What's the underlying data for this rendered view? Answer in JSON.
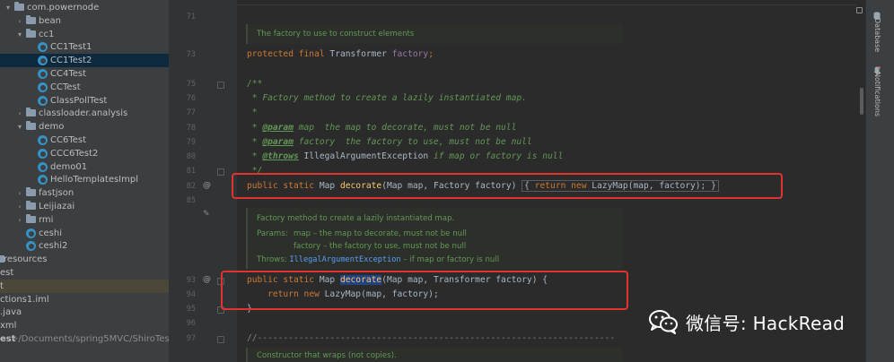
{
  "project_tree": {
    "items": [
      {
        "label": "com.powernode",
        "type": "package",
        "indent": 0,
        "expanded": true
      },
      {
        "label": "bean",
        "type": "folder",
        "indent": 1,
        "expanded": false
      },
      {
        "label": "cc1",
        "type": "folder",
        "indent": 1,
        "expanded": true
      },
      {
        "label": "CC1Test1",
        "type": "class",
        "indent": 2
      },
      {
        "label": "CC1Test2",
        "type": "class",
        "indent": 2,
        "selected": true
      },
      {
        "label": "CC4Test",
        "type": "class",
        "indent": 2
      },
      {
        "label": "CCTest",
        "type": "class",
        "indent": 2
      },
      {
        "label": "ClassPollTest",
        "type": "class",
        "indent": 2
      },
      {
        "label": "classloader.analysis",
        "type": "folder",
        "indent": 1,
        "expanded": false
      },
      {
        "label": "demo",
        "type": "folder",
        "indent": 1,
        "expanded": true
      },
      {
        "label": "CC6Test",
        "type": "class",
        "indent": 2
      },
      {
        "label": "CCC6Test2",
        "type": "class",
        "indent": 2
      },
      {
        "label": "demo01",
        "type": "class",
        "indent": 2
      },
      {
        "label": "HelloTemplatesImpl",
        "type": "class",
        "indent": 2
      },
      {
        "label": "fastjson",
        "type": "folder",
        "indent": 1,
        "expanded": false
      },
      {
        "label": "Leijiazai",
        "type": "folder",
        "indent": 1,
        "expanded": false
      },
      {
        "label": "rmi",
        "type": "folder",
        "indent": 1,
        "expanded": false
      },
      {
        "label": "ceshi",
        "type": "class",
        "indent": 1
      },
      {
        "label": "ceshi2",
        "type": "class",
        "indent": 1
      },
      {
        "label": "resources",
        "type": "folder-plain",
        "indent": 0
      },
      {
        "label": "est",
        "type": "text",
        "indent": -1
      },
      {
        "label": "t",
        "type": "text",
        "indent": -1,
        "highlighted": true
      },
      {
        "label": "ctions1.iml",
        "type": "text",
        "indent": -1
      },
      {
        "label": ".java",
        "type": "text",
        "indent": -1
      },
      {
        "label": "xml",
        "type": "text",
        "indent": -1
      },
      {
        "label": "est",
        "type": "text",
        "indent": -1,
        "bold": true,
        "suffix": "~/Documents/spring5MVC/ShiroTest"
      }
    ]
  },
  "editor": {
    "line_numbers": [
      "71",
      "73",
      "75",
      "76",
      "77",
      "78",
      "79",
      "80",
      "81",
      "82",
      "85",
      "93",
      "94",
      "95",
      "96",
      "97"
    ],
    "doc1": "The factory to use to construct elements",
    "line73": {
      "kw": "protected final",
      "type": "Transformer",
      "field": "factory",
      "end": ";"
    },
    "line75": "/**",
    "line76": " * Factory method to create a lazily instantiated map.",
    "line77": " *",
    "line78": {
      "prefix": " * ",
      "tag": "@param",
      "rest": " map  the map to decorate, must not be null"
    },
    "line79": {
      "prefix": " * ",
      "tag": "@param",
      "rest": " factory  the factory to use, must not be null"
    },
    "line80": {
      "prefix": " * ",
      "tag": "@throws",
      "exc": " IllegalArgumentException",
      "rest": " if map or factory is null"
    },
    "line81": " */",
    "line82": {
      "kw": "public static",
      "type": " Map ",
      "method": "decorate",
      "params": "(Map map, Factory factory) ",
      "open": "{",
      "kw2": " return new",
      "body": " LazyMap(map, factory); ",
      "close": "}"
    },
    "doc2": {
      "summary": "Factory method to create a lazily instantiated map.",
      "params_label": "Params:",
      "param1": "map – the map to decorate, must not be null",
      "param2": "factory – the factory to use, must not be null",
      "throws_label": "Throws:",
      "throws_exc": "IllegalArgumentException",
      "throws_rest": " – if map or factory is null"
    },
    "line93": {
      "kw": "public static",
      "type": " Map ",
      "method": "decorate",
      "params": "(Map map, Transformer factory) {"
    },
    "line94": {
      "kw": "return new",
      "body": " LazyMap(map, factory);"
    },
    "line95": "}",
    "line97": "//---------------------------------------------------------------------",
    "doc3": "Constructor that wraps (not copies)."
  },
  "right_strip": {
    "database": "Database",
    "notifications": "Notifications"
  },
  "watermark": {
    "text": "微信号: HackRead"
  }
}
